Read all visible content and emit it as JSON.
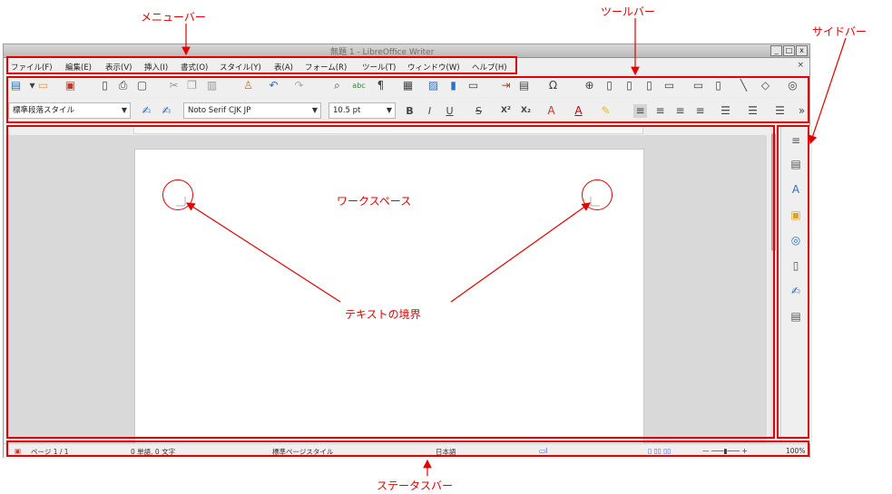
{
  "window": {
    "title": "無題 1 - LibreOffice Writer",
    "buttons": [
      "_",
      "□",
      "x"
    ]
  },
  "menu": {
    "items": [
      "ファイル(F)",
      "編集(E)",
      "表示(V)",
      "挿入(I)",
      "書式(O)",
      "スタイル(Y)",
      "表(A)",
      "フォーム(R)",
      "ツール(T)",
      "ウィンドウ(W)",
      "ヘルプ(H)"
    ],
    "close": "×"
  },
  "toolbar2": {
    "paragraph_style": "標準段落スタイル",
    "font_name": "Noto Serif CJK JP",
    "font_size": "10.5 pt",
    "bold": "B",
    "italic": "I",
    "underline": "U",
    "strike": "S",
    "superscript": "X²",
    "subscript": "X₂",
    "more": "»"
  },
  "status": {
    "page": "ページ 1 / 1",
    "words": "0 単語, 0 文字",
    "page_style": "標準ページスタイル",
    "language": "日本語",
    "zoom": "100%"
  },
  "annotations": {
    "menubar": "メニューバー",
    "toolbar": "ツールバー",
    "sidebar": "サイドバー",
    "workspace": "ワークスペース",
    "text_boundary": "テキストの境界",
    "statusbar": "ステータスバー"
  },
  "colors": {
    "annotation": "#e00000",
    "workspace_bg": "#d9d9d9"
  }
}
